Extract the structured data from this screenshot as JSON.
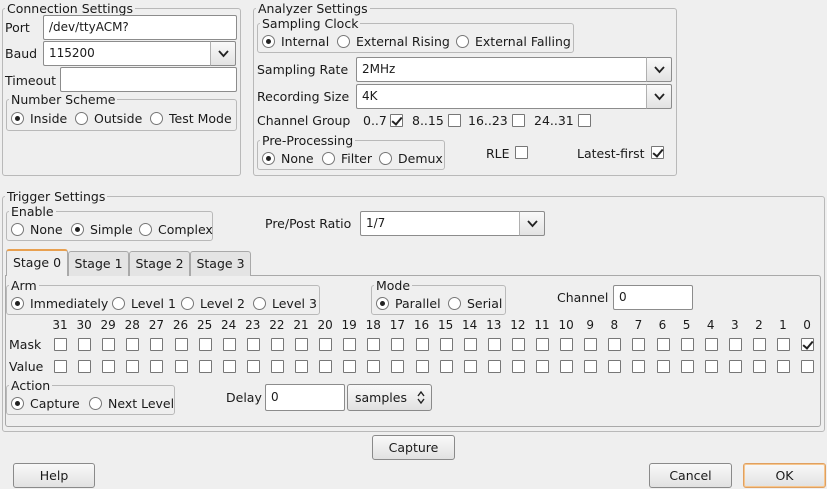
{
  "connection": {
    "legend": "Connection Settings",
    "port_label": "Port",
    "port_value": "/dev/ttyACM?",
    "baud_label": "Baud",
    "baud_value": "115200",
    "timeout_label": "Timeout",
    "timeout_value": "",
    "number_scheme": {
      "legend": "Number Scheme",
      "options": [
        "Inside",
        "Outside",
        "Test Mode"
      ],
      "selected": "Inside"
    }
  },
  "analyzer": {
    "legend": "Analyzer Settings",
    "sampling_clock": {
      "legend": "Sampling Clock",
      "options": [
        "Internal",
        "External Rising",
        "External Falling"
      ],
      "selected": "Internal"
    },
    "sampling_rate_label": "Sampling Rate",
    "sampling_rate_value": "2MHz",
    "recording_size_label": "Recording Size",
    "recording_size_value": "4K",
    "channel_group_label": "Channel Group",
    "channel_groups": [
      {
        "label": "0..7",
        "checked": true
      },
      {
        "label": "8..15",
        "checked": false
      },
      {
        "label": "16..23",
        "checked": false
      },
      {
        "label": "24..31",
        "checked": false
      }
    ],
    "pre_processing": {
      "legend": "Pre-Processing",
      "options": [
        "None",
        "Filter",
        "Demux"
      ],
      "selected": "None"
    },
    "rle_label": "RLE",
    "rle_checked": false,
    "latest_first_label": "Latest-first",
    "latest_first_checked": true
  },
  "trigger": {
    "legend": "Trigger Settings",
    "enable": {
      "legend": "Enable",
      "options": [
        "None",
        "Simple",
        "Complex"
      ],
      "selected": "Simple"
    },
    "pre_post_label": "Pre/Post Ratio",
    "pre_post_value": "1/7",
    "tabs": [
      "Stage 0",
      "Stage 1",
      "Stage 2",
      "Stage 3"
    ],
    "active_tab": "Stage 0",
    "stage": {
      "arm": {
        "legend": "Arm",
        "options": [
          "Immediately",
          "Level 1",
          "Level 2",
          "Level 3"
        ],
        "selected": "Immediately"
      },
      "mode": {
        "legend": "Mode",
        "options": [
          "Parallel",
          "Serial"
        ],
        "selected": "Parallel"
      },
      "channel_label": "Channel",
      "channel_value": "0",
      "bit_numbers": [
        "31",
        "30",
        "29",
        "28",
        "27",
        "26",
        "25",
        "24",
        "23",
        "22",
        "21",
        "20",
        "19",
        "18",
        "17",
        "16",
        "15",
        "14",
        "13",
        "12",
        "11",
        "10",
        "9",
        "8",
        "7",
        "6",
        "5",
        "4",
        "3",
        "2",
        "1",
        "0"
      ],
      "mask_label": "Mask",
      "mask_checked_bits": [
        "0"
      ],
      "value_label": "Value",
      "value_checked_bits": [],
      "action": {
        "legend": "Action",
        "options": [
          "Capture",
          "Next Level"
        ],
        "selected": "Capture"
      },
      "delay_label": "Delay",
      "delay_value": "0",
      "delay_unit": "samples"
    }
  },
  "buttons": {
    "capture": "Capture",
    "help": "Help",
    "cancel": "Cancel",
    "ok": "OK"
  },
  "icons": {
    "combo": "chevron-down-icon",
    "spinner": "spin-updown-icon"
  }
}
